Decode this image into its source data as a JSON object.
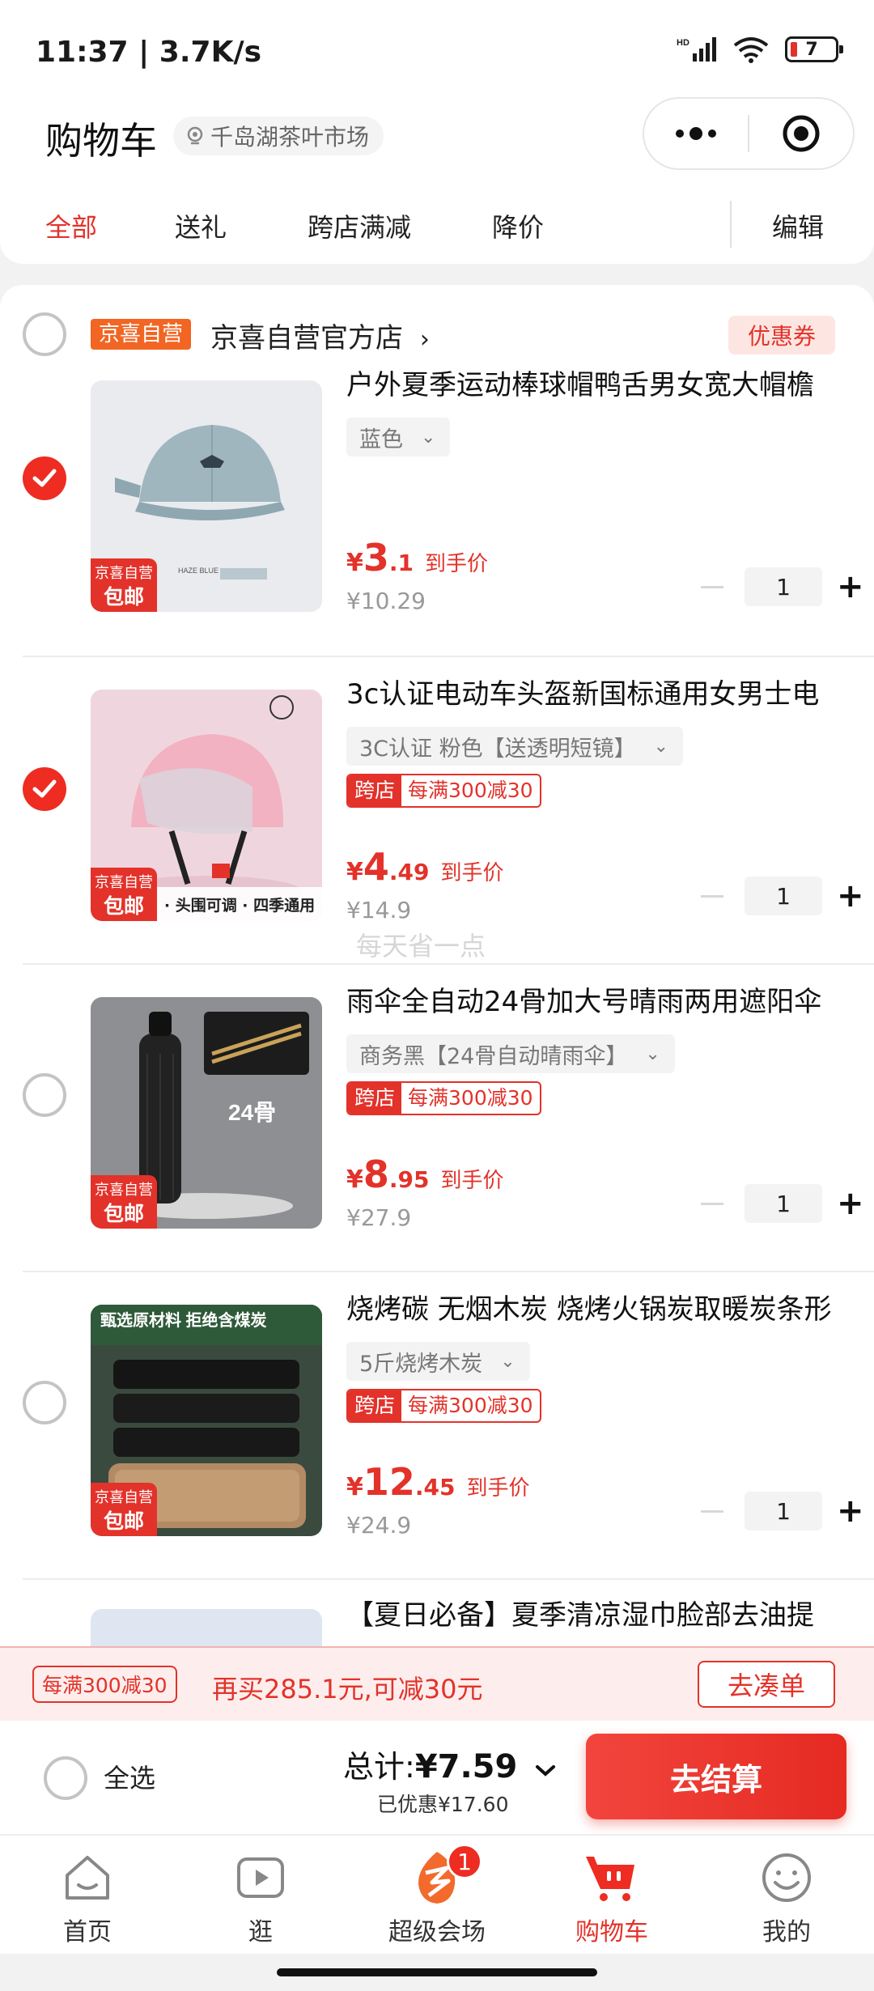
{
  "status_bar": {
    "time": "11:37 | 3.7K/s",
    "battery": "7"
  },
  "header": {
    "title": "购物车",
    "location": "千岛湖茶叶市场"
  },
  "tabs": [
    {
      "label": "全部",
      "active": true
    },
    {
      "label": "送礼",
      "active": false
    },
    {
      "label": "跨店满减",
      "active": false
    },
    {
      "label": "降价",
      "active": false
    }
  ],
  "edit_label": "编辑",
  "shop": {
    "badge": "京喜自营",
    "name": "京喜自营官方店",
    "coupon": "优惠券",
    "selected": false
  },
  "tag": {
    "top": "京喜自营",
    "bottom": "包邮"
  },
  "items": [
    {
      "title": "户外夏季运动棒球帽鸭舌男女宽大帽檐",
      "spec": "蓝色",
      "checked": true,
      "price_int": "3",
      "price_dec": ".1",
      "price_label": "到手价",
      "original": "¥10.29",
      "qty": "1"
    },
    {
      "title": "3c认证电动车头盔新国标通用女男士电",
      "spec": "3C认证 粉色【送透明短镜】",
      "checked": true,
      "promo_tag": "跨店",
      "promo_text": "每满300减30",
      "caption": "· 头围可调 · 四季通用",
      "price_int": "4",
      "price_dec": ".49",
      "price_label": "到手价",
      "original": "¥14.9",
      "qty": "1"
    },
    {
      "title": "雨伞全自动24骨加大号晴雨两用遮阳伞",
      "spec": "商务黑【24骨自动晴雨伞】",
      "checked": false,
      "promo_tag": "跨店",
      "promo_text": "每满300减30",
      "image_text": "24骨",
      "price_int": "8",
      "price_dec": ".95",
      "price_label": "到手价",
      "original": "¥27.9",
      "qty": "1"
    },
    {
      "title": "烧烤碳 无烟木炭 烧烤火锅炭取暖炭条形",
      "spec": "5斤烧烤木炭",
      "checked": false,
      "promo_tag": "跨店",
      "promo_text": "每满300减30",
      "image_text": "甄选原材料 拒绝含煤炭",
      "price_int": "12",
      "price_dec": ".45",
      "price_label": "到手价",
      "original": "¥24.9",
      "qty": "1"
    },
    {
      "title": "【夏日必备】夏季清凉湿巾脸部去油提"
    }
  ],
  "currency": "¥",
  "watermark": "每天省一点",
  "promo_bar": {
    "chip": "每满300减30",
    "message": "再买285.1元,可减30元",
    "button": "去凑单"
  },
  "checkout": {
    "select_all": "全选",
    "total_label": "总计:",
    "total_amount": "¥7.59",
    "saved": "已优惠¥17.60",
    "pay_button": "去结算"
  },
  "bottom_nav": [
    {
      "label": "首页",
      "icon": "home-icon"
    },
    {
      "label": "逛",
      "icon": "video-play-icon"
    },
    {
      "label": "超级会场",
      "icon": "super-venue-icon",
      "badge": "1"
    },
    {
      "label": "购物车",
      "icon": "cart-icon",
      "active": true
    },
    {
      "label": "我的",
      "icon": "profile-icon"
    }
  ],
  "colors": {
    "accent": "#e3322a",
    "shop_badge": "#f26522"
  }
}
